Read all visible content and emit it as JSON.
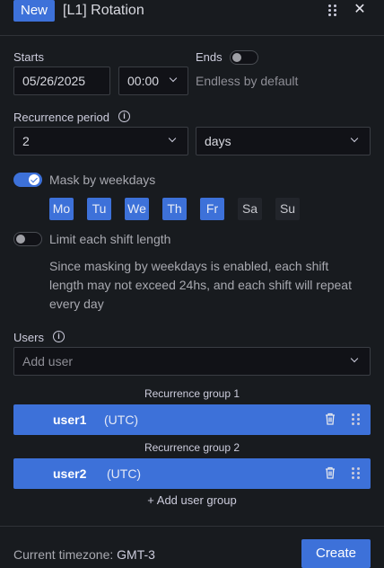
{
  "header": {
    "badge": "New",
    "title": "[L1] Rotation",
    "drag_icon": "drag-handle-icon",
    "close_icon": "close-icon"
  },
  "starts": {
    "label": "Starts",
    "date": "05/26/2025",
    "time": "00:00"
  },
  "ends": {
    "label": "Ends",
    "toggle_on": false,
    "hint": "Endless by default"
  },
  "recurrence": {
    "label": "Recurrence period",
    "value": "2",
    "unit": "days"
  },
  "mask": {
    "toggle_on": true,
    "label": "Mask by weekdays",
    "days": [
      {
        "label": "Mo",
        "selected": true
      },
      {
        "label": "Tu",
        "selected": true
      },
      {
        "label": "We",
        "selected": true
      },
      {
        "label": "Th",
        "selected": true
      },
      {
        "label": "Fr",
        "selected": true
      },
      {
        "label": "Sa",
        "selected": false
      },
      {
        "label": "Su",
        "selected": false
      }
    ]
  },
  "limit": {
    "toggle_on": false,
    "label": "Limit each shift length",
    "note": "Since masking by weekdays is enabled, each shift length may not exceed 24hs, and each shift will repeat every day"
  },
  "users": {
    "label": "Users",
    "placeholder": "Add user",
    "groups": [
      {
        "title": "Recurrence group 1",
        "user": "user1",
        "tz": "(UTC)"
      },
      {
        "title": "Recurrence group 2",
        "user": "user2",
        "tz": "(UTC)"
      }
    ],
    "add_group": "+ Add user group"
  },
  "footer": {
    "tz_label": "Current timezone:",
    "tz_value": "GMT-3",
    "create": "Create"
  },
  "colors": {
    "accent": "#3d71d9",
    "background": "#181b1f"
  }
}
